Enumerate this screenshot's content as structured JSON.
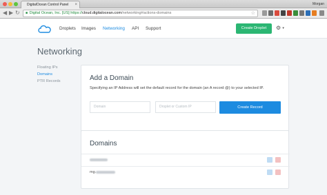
{
  "browser": {
    "tab_title": "DigitalOcean Control Panel",
    "tab_close": "×",
    "user_label": "Morgan",
    "ssl_owner": "Digital Ocean, Inc. [US]",
    "url_scheme": "https://",
    "url_host": "cloud.digitalocean.com",
    "url_path": "/networking#actions-domains",
    "back": "◀",
    "forward": "▶",
    "reload": "↻",
    "star": "☆"
  },
  "header": {
    "nav": [
      "Droplets",
      "Images",
      "Networking",
      "API",
      "Support"
    ],
    "active_nav": "Networking",
    "create_button": "Create Droplet",
    "settings_icon": "⚙",
    "settings_caret": "▾"
  },
  "page_title": "Networking",
  "sidebar": {
    "items": [
      "Floating IPs",
      "Domains",
      "PTR Records"
    ],
    "active": "Domains"
  },
  "add_domain": {
    "title": "Add a Domain",
    "description": "Specifying an IP Address will set the default record for the domain (an A record @) to your selected IP.",
    "domain_placeholder": "Domain",
    "ip_placeholder": "Droplet or Custom IP",
    "submit": "Create Record"
  },
  "domains": {
    "title": "Domains",
    "rows": [
      {
        "prefix": ""
      },
      {
        "prefix": "mg."
      }
    ]
  },
  "colors": {
    "accent_blue": "#1d8be0",
    "create_green": "#2bb673"
  }
}
